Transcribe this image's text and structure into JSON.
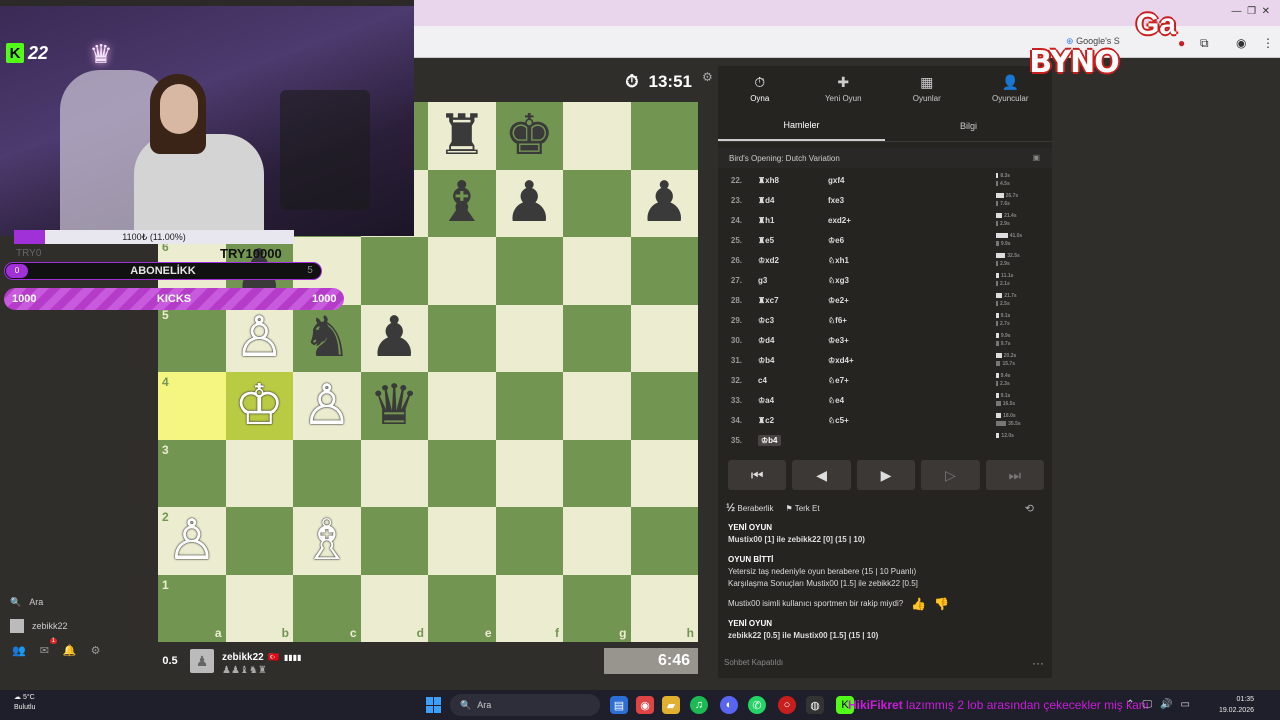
{
  "browser": {
    "google_tab": "Google's S"
  },
  "clock_top": "13:51",
  "clock_bottom": "6:46",
  "player_bottom": {
    "score": "0.5",
    "name": "zebikk22",
    "flag": "🇹🇷",
    "captured": "♟♟♝♞♜"
  },
  "board": {
    "files": [
      "a",
      "b",
      "c",
      "d",
      "e",
      "f",
      "g",
      "h"
    ],
    "ranks": [
      "8",
      "7",
      "6",
      "5",
      "4",
      "3",
      "2",
      "1"
    ],
    "pieces": {
      "e8": {
        "glyph": "♜",
        "color": "b",
        "name": "black-rook"
      },
      "f8": {
        "glyph": "♚",
        "color": "b",
        "name": "black-king"
      },
      "e7": {
        "glyph": "♝",
        "color": "b",
        "name": "black-bishop"
      },
      "f7": {
        "glyph": "♟",
        "color": "b",
        "name": "black-pawn"
      },
      "h7": {
        "glyph": "♟",
        "color": "b",
        "name": "black-pawn"
      },
      "b6": {
        "glyph": "♟",
        "color": "b",
        "name": "black-pawn"
      },
      "b5": {
        "glyph": "♙",
        "color": "w",
        "name": "white-pawn"
      },
      "c5": {
        "glyph": "♞",
        "color": "b",
        "name": "black-knight"
      },
      "d5": {
        "glyph": "♟",
        "color": "b",
        "name": "black-pawn"
      },
      "b4": {
        "glyph": "♔",
        "color": "w",
        "name": "white-king"
      },
      "c4": {
        "glyph": "♙",
        "color": "w",
        "name": "white-pawn"
      },
      "d4": {
        "glyph": "♛",
        "color": "b",
        "name": "black-queen"
      },
      "a2": {
        "glyph": "♙",
        "color": "w",
        "name": "white-pawn"
      },
      "c2": {
        "glyph": "♗",
        "color": "w",
        "name": "white-bishop"
      }
    },
    "highlight_from": "a4",
    "highlight_to": "b4"
  },
  "panel": {
    "tabs": [
      {
        "label": "Oyna",
        "icon": "⏱",
        "name": "tab-play"
      },
      {
        "label": "Yeni Oyun",
        "icon": "✚",
        "name": "tab-new-game"
      },
      {
        "label": "Oyunlar",
        "icon": "▦",
        "name": "tab-games"
      },
      {
        "label": "Oyuncular",
        "icon": "👤",
        "name": "tab-players"
      }
    ],
    "subtabs": [
      "Hamleler",
      "Bilgi"
    ],
    "opening": "Bird's Opening: Dutch Variation",
    "moves": [
      {
        "num": "22.",
        "w": "♜xh8",
        "b": "gxf4",
        "tw": "8.3s",
        "tb": "4.5s"
      },
      {
        "num": "23.",
        "w": "♜d4",
        "b": "fxe3",
        "tw": "26.7s",
        "tb": "7.6s"
      },
      {
        "num": "24.",
        "w": "♜h1",
        "b": "exd2+",
        "tw": "21.4s",
        "tb": "2.9s"
      },
      {
        "num": "25.",
        "w": "♜e5",
        "b": "♔e6",
        "tw": "41.0s",
        "tb": "9.9s"
      },
      {
        "num": "26.",
        "w": "♔xd2",
        "b": "♘xh1",
        "tw": "32.5s",
        "tb": "2.9s"
      },
      {
        "num": "27.",
        "w": "g3",
        "b": "♘xg3",
        "tw": "11.1s",
        "tb": "2.1s"
      },
      {
        "num": "28.",
        "w": "♜xc7",
        "b": "♔e2+",
        "tw": "21.7s",
        "tb": "2.5s"
      },
      {
        "num": "29.",
        "w": "♔c3",
        "b": "♘f6+",
        "tw": "9.1s",
        "tb": "2.7s"
      },
      {
        "num": "30.",
        "w": "♔d4",
        "b": "♔e3+",
        "tw": "9.9s",
        "tb": "9.7s"
      },
      {
        "num": "31.",
        "w": "♔b4",
        "b": "♔xd4+",
        "tw": "20.2s",
        "tb": "15.7s"
      },
      {
        "num": "32.",
        "w": "c4",
        "b": "♘e7+",
        "tw": "9.4s",
        "tb": "2.3s"
      },
      {
        "num": "33.",
        "w": "♔a4",
        "b": "♘e4",
        "tw": "9.1s",
        "tb": "16.5s"
      },
      {
        "num": "34.",
        "w": "♜c2",
        "b": "♘c5+",
        "tw": "18.0s",
        "tb": "35.5s"
      },
      {
        "num": "35.",
        "w": "♔b4",
        "b": "",
        "tw": "12.0s",
        "tb": ""
      }
    ],
    "nav": [
      "⏮",
      "◀",
      "▶",
      "▷",
      "⏭"
    ],
    "draw_label": "Beraberlik",
    "draw_icon": "½",
    "resign_label": "Terk Et",
    "resign_icon": "⚑",
    "chat": {
      "new_game_1": "YENİ OYUN",
      "new_game_1_text": "Mustix00 [1] ile zebikk22 [0] (15 | 10)",
      "game_over": "OYUN BİTTİ",
      "game_over_reason": "Yetersiz taş nedeniyle oyun berabere (15 | 10 Puanlı)",
      "game_over_result": "Karşılaşma Sonuçları Mustix00 [1.5] ile zebikk22 [0.5]",
      "sportsman_question": "Mustix00 isimli kullanıcı sportmen bir rakip miydi?",
      "new_game_2": "YENİ OYUN",
      "new_game_2_text": "zebikk22 [0.5] ile Mustix00 [1.5] (15 | 10)"
    },
    "chat_closed": "Sohbet Kapatıldı"
  },
  "sidebar": {
    "search_label": "Ara",
    "user_label": "zebikk22",
    "notification_count": "1"
  },
  "overlay": {
    "kick_count": "22",
    "donation_text": "1100₺ (11.00%)",
    "donation_percent": 0.11,
    "try_left": "TRY0",
    "try_right": "TRY10000",
    "sub_left": "0",
    "sub_label": "ABONELİKK",
    "sub_right": "5",
    "kicks_left": "1000",
    "kicks_label": "KICKS",
    "kicks_right": "1000",
    "brand": "BYNO",
    "brand_g": "Ga"
  },
  "taskbar": {
    "weather_temp": "5°C",
    "weather_desc": "Bulutlu",
    "search_label": "Ara",
    "ticker_name": "HikiFikret",
    "ticker_text": "lazımmış 2 lob arasından çekecekler miş kanı",
    "time": "01:35",
    "date": "19.02.2026"
  }
}
